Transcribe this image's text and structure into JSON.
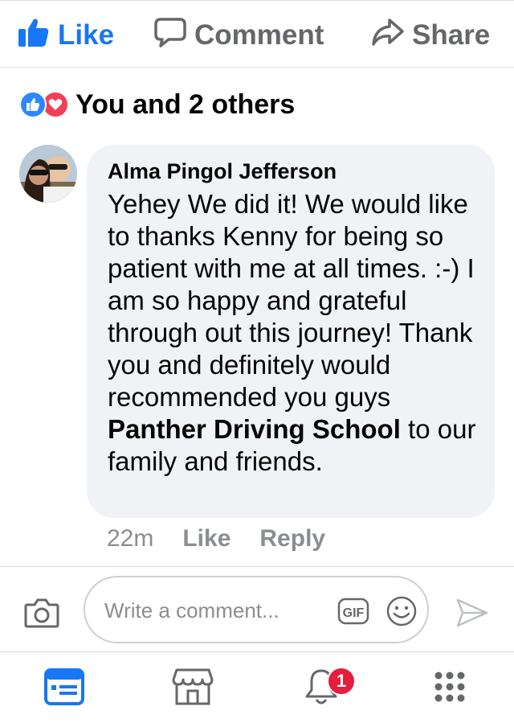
{
  "actions": {
    "like_label": "Like",
    "comment_label": "Comment",
    "share_label": "Share"
  },
  "reactions": {
    "summary": "You and 2 others",
    "types": [
      "like-icon",
      "love-icon"
    ]
  },
  "comment": {
    "author": "Alma Pingol Jefferson",
    "text_before": "Yehey We did it! We would like to thanks Kenny for being so patient with me at all times. :-)  I am so happy and grateful through out this journey! Thank you and definitely would recommended you guys ",
    "mention": "Panther Driving School",
    "text_after": " to our family and friends.",
    "time": "22m",
    "like_label": "Like",
    "reply_label": "Reply"
  },
  "composer": {
    "placeholder": "Write a comment...",
    "gif_label": "GIF"
  },
  "bottom_nav": {
    "items": [
      "news-feed-icon",
      "marketplace-icon",
      "notifications-icon",
      "menu-icon"
    ],
    "notification_count": "1"
  },
  "colors": {
    "accent": "#1877f2",
    "muted": "#65676b",
    "bubble": "#f0f2f5",
    "badge": "#e41e3f",
    "love": "#f33e58"
  }
}
